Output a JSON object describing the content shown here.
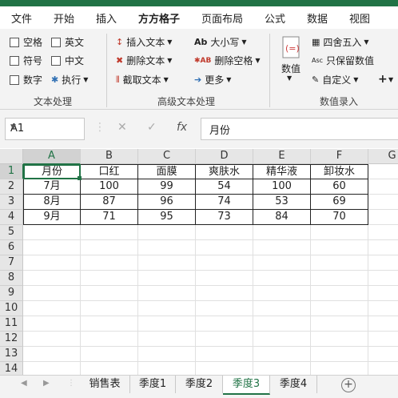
{
  "menu": {
    "items": [
      "文件",
      "开始",
      "插入",
      "方方格子",
      "页面布局",
      "公式",
      "数据",
      "视图"
    ],
    "active": "方方格子"
  },
  "ribbon": {
    "text_group": {
      "label": "文本处理",
      "options": [
        "空格",
        "英文",
        "符号",
        "中文",
        "数字",
        "执行"
      ]
    },
    "advanced_group": {
      "label": "高级文本处理",
      "buttons": [
        "插入文本",
        "删除文本",
        "截取文本",
        "大小写",
        "删除空格",
        "更多"
      ]
    },
    "number_group": {
      "label": "数值录入",
      "big_button": "数值",
      "buttons": [
        "四舍五入",
        "只保留数值",
        "自定义"
      ]
    }
  },
  "formula_bar": {
    "name_box": "A1",
    "cancel": "✕",
    "enter": "✓",
    "fx": "fx",
    "content": "月份"
  },
  "sheet": {
    "columns": [
      "A",
      "B",
      "C",
      "D",
      "E",
      "F",
      "G"
    ],
    "selected_column": "A",
    "selected_row": 1,
    "rows": [
      "1",
      "2",
      "3",
      "4",
      "5",
      "6",
      "7",
      "8",
      "9",
      "10",
      "11",
      "12",
      "13",
      "14"
    ],
    "table": [
      [
        "月份",
        "口红",
        "面膜",
        "爽肤水",
        "精华液",
        "卸妆水"
      ],
      [
        "7月",
        "100",
        "99",
        "54",
        "100",
        "60"
      ],
      [
        "8月",
        "87",
        "96",
        "74",
        "53",
        "69"
      ],
      [
        "9月",
        "71",
        "95",
        "73",
        "84",
        "70"
      ]
    ]
  },
  "tabs": {
    "items": [
      "销售表",
      "季度1",
      "季度2",
      "季度3",
      "季度4"
    ],
    "active": "季度3"
  },
  "colors": {
    "accent": "#217346"
  }
}
